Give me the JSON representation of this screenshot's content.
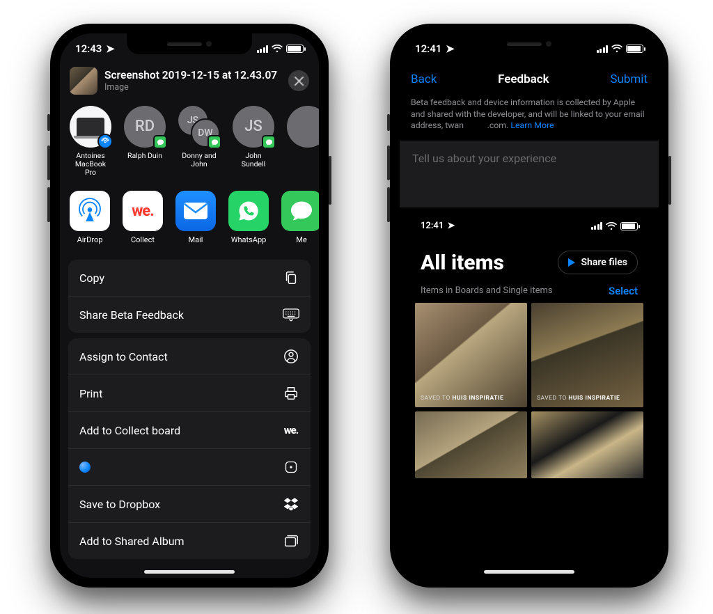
{
  "left": {
    "status_time": "12:43",
    "share": {
      "title": "Screenshot 2019-12-15 at 12.43.07",
      "subtitle": "Image"
    },
    "contacts": [
      {
        "label": "Antoines MacBook Pro",
        "initials": "",
        "kind": "macbook"
      },
      {
        "label": "Ralph Duin",
        "initials": "RD",
        "kind": "msg"
      },
      {
        "label": "Donny and John",
        "initials": "JS",
        "initials2": "DW",
        "kind": "double"
      },
      {
        "label": "John Sundell",
        "initials": "JS",
        "kind": "msg"
      }
    ],
    "apps": [
      {
        "label": "AirDrop"
      },
      {
        "label": "Collect"
      },
      {
        "label": "Mail"
      },
      {
        "label": "WhatsApp"
      },
      {
        "label": "Me"
      }
    ],
    "group1": [
      {
        "label": "Copy",
        "icon": "copy"
      },
      {
        "label": "Share Beta Feedback",
        "icon": "keyboard"
      }
    ],
    "group2": [
      {
        "label": "Assign to Contact",
        "icon": "contact"
      },
      {
        "label": "Print",
        "icon": "print"
      },
      {
        "label": "Add to Collect board",
        "icon": "collect"
      },
      {
        "label": "",
        "icon": "bluedot"
      },
      {
        "label": "Save to Dropbox",
        "icon": "dropbox"
      },
      {
        "label": "Add to Shared Album",
        "icon": "album"
      }
    ]
  },
  "right": {
    "status_time": "12:41",
    "nav": {
      "back": "Back",
      "title": "Feedback",
      "submit": "Submit"
    },
    "info_prefix": "Beta feedback and device information is collected by Apple and shared with the developer, and will be linked to your email address, twan",
    "info_suffix": ".com.",
    "learn_more": "Learn More",
    "placeholder": "Tell us about your experience",
    "mini": {
      "status_time": "12:41",
      "title": "All items",
      "share_label": "Share files",
      "sub_text": "Items in Boards and Single items",
      "select": "Select",
      "chip_prefix": "SAVED TO",
      "chip_board": "HUIS INSPIRATIE"
    }
  }
}
